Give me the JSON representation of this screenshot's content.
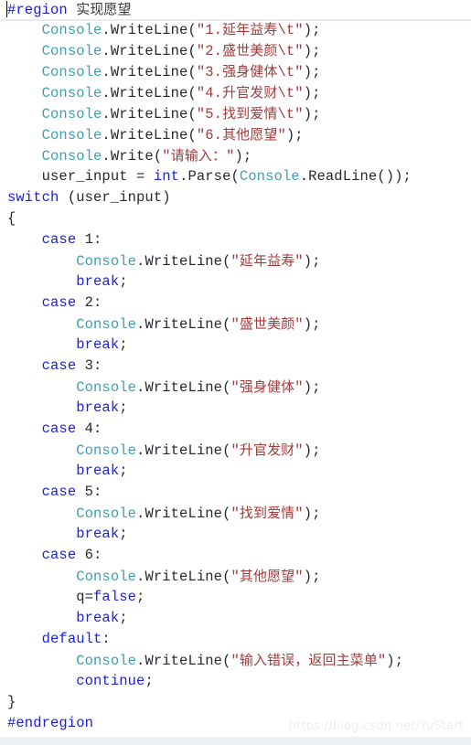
{
  "editor": {
    "language": "csharp",
    "background_color": "#ffffff",
    "caret_visible": true,
    "colors": {
      "preprocessor": "#1a1ae0",
      "keyword": "#1d21e8",
      "type": "#3f9fb0",
      "string": "#a33b3b",
      "plain": "#26292e",
      "watermark": "#eceef0",
      "rule": "#e8ecf2"
    }
  },
  "watermark": {
    "text": "https://blog.csdn.net/YuStart"
  },
  "code": {
    "lines": [
      {
        "indent": 0,
        "tokens": [
          {
            "c": "t-pre",
            "t": "#region"
          },
          {
            "c": "t-plain",
            "t": " "
          },
          {
            "c": "t-cmt cjk",
            "t": "实现愿望"
          }
        ]
      },
      {
        "indent": 4,
        "tokens": [
          {
            "c": "t-type",
            "t": "Console"
          },
          {
            "c": "t-plain",
            "t": "."
          },
          {
            "c": "t-plain",
            "t": "WriteLine"
          },
          {
            "c": "t-plain",
            "t": "("
          },
          {
            "c": "t-str",
            "t": "\"1."
          },
          {
            "c": "t-str cjk",
            "t": "延年益寿"
          },
          {
            "c": "t-str",
            "t": "\\t\""
          },
          {
            "c": "t-plain",
            "t": ");"
          }
        ]
      },
      {
        "indent": 4,
        "tokens": [
          {
            "c": "t-type",
            "t": "Console"
          },
          {
            "c": "t-plain",
            "t": "."
          },
          {
            "c": "t-plain",
            "t": "WriteLine"
          },
          {
            "c": "t-plain",
            "t": "("
          },
          {
            "c": "t-str",
            "t": "\"2."
          },
          {
            "c": "t-str cjk",
            "t": "盛世美颜"
          },
          {
            "c": "t-str",
            "t": "\\t\""
          },
          {
            "c": "t-plain",
            "t": ");"
          }
        ]
      },
      {
        "indent": 4,
        "tokens": [
          {
            "c": "t-type",
            "t": "Console"
          },
          {
            "c": "t-plain",
            "t": "."
          },
          {
            "c": "t-plain",
            "t": "WriteLine"
          },
          {
            "c": "t-plain",
            "t": "("
          },
          {
            "c": "t-str",
            "t": "\"3."
          },
          {
            "c": "t-str cjk",
            "t": "强身健体"
          },
          {
            "c": "t-str",
            "t": "\\t\""
          },
          {
            "c": "t-plain",
            "t": ");"
          }
        ]
      },
      {
        "indent": 4,
        "tokens": [
          {
            "c": "t-type",
            "t": "Console"
          },
          {
            "c": "t-plain",
            "t": "."
          },
          {
            "c": "t-plain",
            "t": "WriteLine"
          },
          {
            "c": "t-plain",
            "t": "("
          },
          {
            "c": "t-str",
            "t": "\"4."
          },
          {
            "c": "t-str cjk",
            "t": "升官发财"
          },
          {
            "c": "t-str",
            "t": "\\t\""
          },
          {
            "c": "t-plain",
            "t": ");"
          }
        ]
      },
      {
        "indent": 4,
        "tokens": [
          {
            "c": "t-type",
            "t": "Console"
          },
          {
            "c": "t-plain",
            "t": "."
          },
          {
            "c": "t-plain",
            "t": "WriteLine"
          },
          {
            "c": "t-plain",
            "t": "("
          },
          {
            "c": "t-str",
            "t": "\"5."
          },
          {
            "c": "t-str cjk",
            "t": "找到爱情"
          },
          {
            "c": "t-str",
            "t": "\\t\""
          },
          {
            "c": "t-plain",
            "t": ");"
          }
        ]
      },
      {
        "indent": 4,
        "tokens": [
          {
            "c": "t-type",
            "t": "Console"
          },
          {
            "c": "t-plain",
            "t": "."
          },
          {
            "c": "t-plain",
            "t": "WriteLine"
          },
          {
            "c": "t-plain",
            "t": "("
          },
          {
            "c": "t-str",
            "t": "\"6."
          },
          {
            "c": "t-str cjk",
            "t": "其他愿望"
          },
          {
            "c": "t-str",
            "t": "\""
          },
          {
            "c": "t-plain",
            "t": ");"
          }
        ]
      },
      {
        "indent": 4,
        "tokens": [
          {
            "c": "t-type",
            "t": "Console"
          },
          {
            "c": "t-plain",
            "t": "."
          },
          {
            "c": "t-plain",
            "t": "Write"
          },
          {
            "c": "t-plain",
            "t": "("
          },
          {
            "c": "t-str",
            "t": "\""
          },
          {
            "c": "t-str cjk",
            "t": "请输入："
          },
          {
            "c": "t-str",
            "t": "\""
          },
          {
            "c": "t-plain",
            "t": ");"
          }
        ]
      },
      {
        "indent": 4,
        "tokens": [
          {
            "c": "t-plain",
            "t": "user_input = "
          },
          {
            "c": "t-kw",
            "t": "int"
          },
          {
            "c": "t-plain",
            "t": ".Parse("
          },
          {
            "c": "t-type",
            "t": "Console"
          },
          {
            "c": "t-plain",
            "t": ".ReadLine());"
          }
        ]
      },
      {
        "indent": 0,
        "tokens": [
          {
            "c": "t-kw",
            "t": "switch"
          },
          {
            "c": "t-plain",
            "t": " (user_input)"
          }
        ]
      },
      {
        "indent": 0,
        "tokens": [
          {
            "c": "t-plain",
            "t": "{"
          }
        ]
      },
      {
        "indent": 4,
        "tokens": [
          {
            "c": "t-kw",
            "t": "case"
          },
          {
            "c": "t-plain",
            "t": " "
          },
          {
            "c": "t-num",
            "t": "1"
          },
          {
            "c": "t-plain",
            "t": ":"
          }
        ]
      },
      {
        "indent": 8,
        "tokens": [
          {
            "c": "t-type",
            "t": "Console"
          },
          {
            "c": "t-plain",
            "t": "."
          },
          {
            "c": "t-plain",
            "t": "WriteLine"
          },
          {
            "c": "t-plain",
            "t": "("
          },
          {
            "c": "t-str",
            "t": "\""
          },
          {
            "c": "t-str cjk",
            "t": "延年益寿"
          },
          {
            "c": "t-str",
            "t": "\""
          },
          {
            "c": "t-plain",
            "t": ");"
          }
        ]
      },
      {
        "indent": 8,
        "tokens": [
          {
            "c": "t-kw",
            "t": "break"
          },
          {
            "c": "t-plain",
            "t": ";"
          }
        ]
      },
      {
        "indent": 4,
        "tokens": [
          {
            "c": "t-kw",
            "t": "case"
          },
          {
            "c": "t-plain",
            "t": " "
          },
          {
            "c": "t-num",
            "t": "2"
          },
          {
            "c": "t-plain",
            "t": ":"
          }
        ]
      },
      {
        "indent": 8,
        "tokens": [
          {
            "c": "t-type",
            "t": "Console"
          },
          {
            "c": "t-plain",
            "t": "."
          },
          {
            "c": "t-plain",
            "t": "WriteLine"
          },
          {
            "c": "t-plain",
            "t": "("
          },
          {
            "c": "t-str",
            "t": "\""
          },
          {
            "c": "t-str cjk",
            "t": "盛世美颜"
          },
          {
            "c": "t-str",
            "t": "\""
          },
          {
            "c": "t-plain",
            "t": ");"
          }
        ]
      },
      {
        "indent": 8,
        "tokens": [
          {
            "c": "t-kw",
            "t": "break"
          },
          {
            "c": "t-plain",
            "t": ";"
          }
        ]
      },
      {
        "indent": 4,
        "tokens": [
          {
            "c": "t-kw",
            "t": "case"
          },
          {
            "c": "t-plain",
            "t": " "
          },
          {
            "c": "t-num",
            "t": "3"
          },
          {
            "c": "t-plain",
            "t": ":"
          }
        ]
      },
      {
        "indent": 8,
        "tokens": [
          {
            "c": "t-type",
            "t": "Console"
          },
          {
            "c": "t-plain",
            "t": "."
          },
          {
            "c": "t-plain",
            "t": "WriteLine"
          },
          {
            "c": "t-plain",
            "t": "("
          },
          {
            "c": "t-str",
            "t": "\""
          },
          {
            "c": "t-str cjk",
            "t": "强身健体"
          },
          {
            "c": "t-str",
            "t": "\""
          },
          {
            "c": "t-plain",
            "t": ");"
          }
        ]
      },
      {
        "indent": 8,
        "tokens": [
          {
            "c": "t-kw",
            "t": "break"
          },
          {
            "c": "t-plain",
            "t": ";"
          }
        ]
      },
      {
        "indent": 4,
        "tokens": [
          {
            "c": "t-kw",
            "t": "case"
          },
          {
            "c": "t-plain",
            "t": " "
          },
          {
            "c": "t-num",
            "t": "4"
          },
          {
            "c": "t-plain",
            "t": ":"
          }
        ]
      },
      {
        "indent": 8,
        "tokens": [
          {
            "c": "t-type",
            "t": "Console"
          },
          {
            "c": "t-plain",
            "t": "."
          },
          {
            "c": "t-plain",
            "t": "WriteLine"
          },
          {
            "c": "t-plain",
            "t": "("
          },
          {
            "c": "t-str",
            "t": "\""
          },
          {
            "c": "t-str cjk",
            "t": "升官发财"
          },
          {
            "c": "t-str",
            "t": "\""
          },
          {
            "c": "t-plain",
            "t": ");"
          }
        ]
      },
      {
        "indent": 8,
        "tokens": [
          {
            "c": "t-kw",
            "t": "break"
          },
          {
            "c": "t-plain",
            "t": ";"
          }
        ]
      },
      {
        "indent": 4,
        "tokens": [
          {
            "c": "t-kw",
            "t": "case"
          },
          {
            "c": "t-plain",
            "t": " "
          },
          {
            "c": "t-num",
            "t": "5"
          },
          {
            "c": "t-plain",
            "t": ":"
          }
        ]
      },
      {
        "indent": 8,
        "tokens": [
          {
            "c": "t-type",
            "t": "Console"
          },
          {
            "c": "t-plain",
            "t": "."
          },
          {
            "c": "t-plain",
            "t": "WriteLine"
          },
          {
            "c": "t-plain",
            "t": "("
          },
          {
            "c": "t-str",
            "t": "\""
          },
          {
            "c": "t-str cjk",
            "t": "找到爱情"
          },
          {
            "c": "t-str",
            "t": "\""
          },
          {
            "c": "t-plain",
            "t": ");"
          }
        ]
      },
      {
        "indent": 8,
        "tokens": [
          {
            "c": "t-kw",
            "t": "break"
          },
          {
            "c": "t-plain",
            "t": ";"
          }
        ]
      },
      {
        "indent": 4,
        "tokens": [
          {
            "c": "t-kw",
            "t": "case"
          },
          {
            "c": "t-plain",
            "t": " "
          },
          {
            "c": "t-num",
            "t": "6"
          },
          {
            "c": "t-plain",
            "t": ":"
          }
        ]
      },
      {
        "indent": 8,
        "tokens": [
          {
            "c": "t-type",
            "t": "Console"
          },
          {
            "c": "t-plain",
            "t": "."
          },
          {
            "c": "t-plain",
            "t": "WriteLine"
          },
          {
            "c": "t-plain",
            "t": "("
          },
          {
            "c": "t-str",
            "t": "\""
          },
          {
            "c": "t-str cjk",
            "t": "其他愿望"
          },
          {
            "c": "t-str",
            "t": "\""
          },
          {
            "c": "t-plain",
            "t": ");"
          }
        ]
      },
      {
        "indent": 8,
        "tokens": [
          {
            "c": "t-plain",
            "t": "q="
          },
          {
            "c": "t-kw",
            "t": "false"
          },
          {
            "c": "t-plain",
            "t": ";"
          }
        ]
      },
      {
        "indent": 8,
        "tokens": [
          {
            "c": "t-kw",
            "t": "break"
          },
          {
            "c": "t-plain",
            "t": ";"
          }
        ]
      },
      {
        "indent": 4,
        "tokens": [
          {
            "c": "t-kw",
            "t": "default"
          },
          {
            "c": "t-plain",
            "t": ":"
          }
        ]
      },
      {
        "indent": 8,
        "tokens": [
          {
            "c": "t-type",
            "t": "Console"
          },
          {
            "c": "t-plain",
            "t": "."
          },
          {
            "c": "t-plain",
            "t": "WriteLine"
          },
          {
            "c": "t-plain",
            "t": "("
          },
          {
            "c": "t-str",
            "t": "\""
          },
          {
            "c": "t-str cjk",
            "t": "输入错误，返回主菜单"
          },
          {
            "c": "t-str",
            "t": "\""
          },
          {
            "c": "t-plain",
            "t": ");"
          }
        ]
      },
      {
        "indent": 8,
        "tokens": [
          {
            "c": "t-kw",
            "t": "continue"
          },
          {
            "c": "t-plain",
            "t": ";"
          }
        ]
      },
      {
        "indent": 0,
        "tokens": [
          {
            "c": "t-plain",
            "t": "}"
          }
        ]
      },
      {
        "indent": 0,
        "tokens": [
          {
            "c": "t-pre",
            "t": "#endregion"
          }
        ]
      }
    ]
  }
}
